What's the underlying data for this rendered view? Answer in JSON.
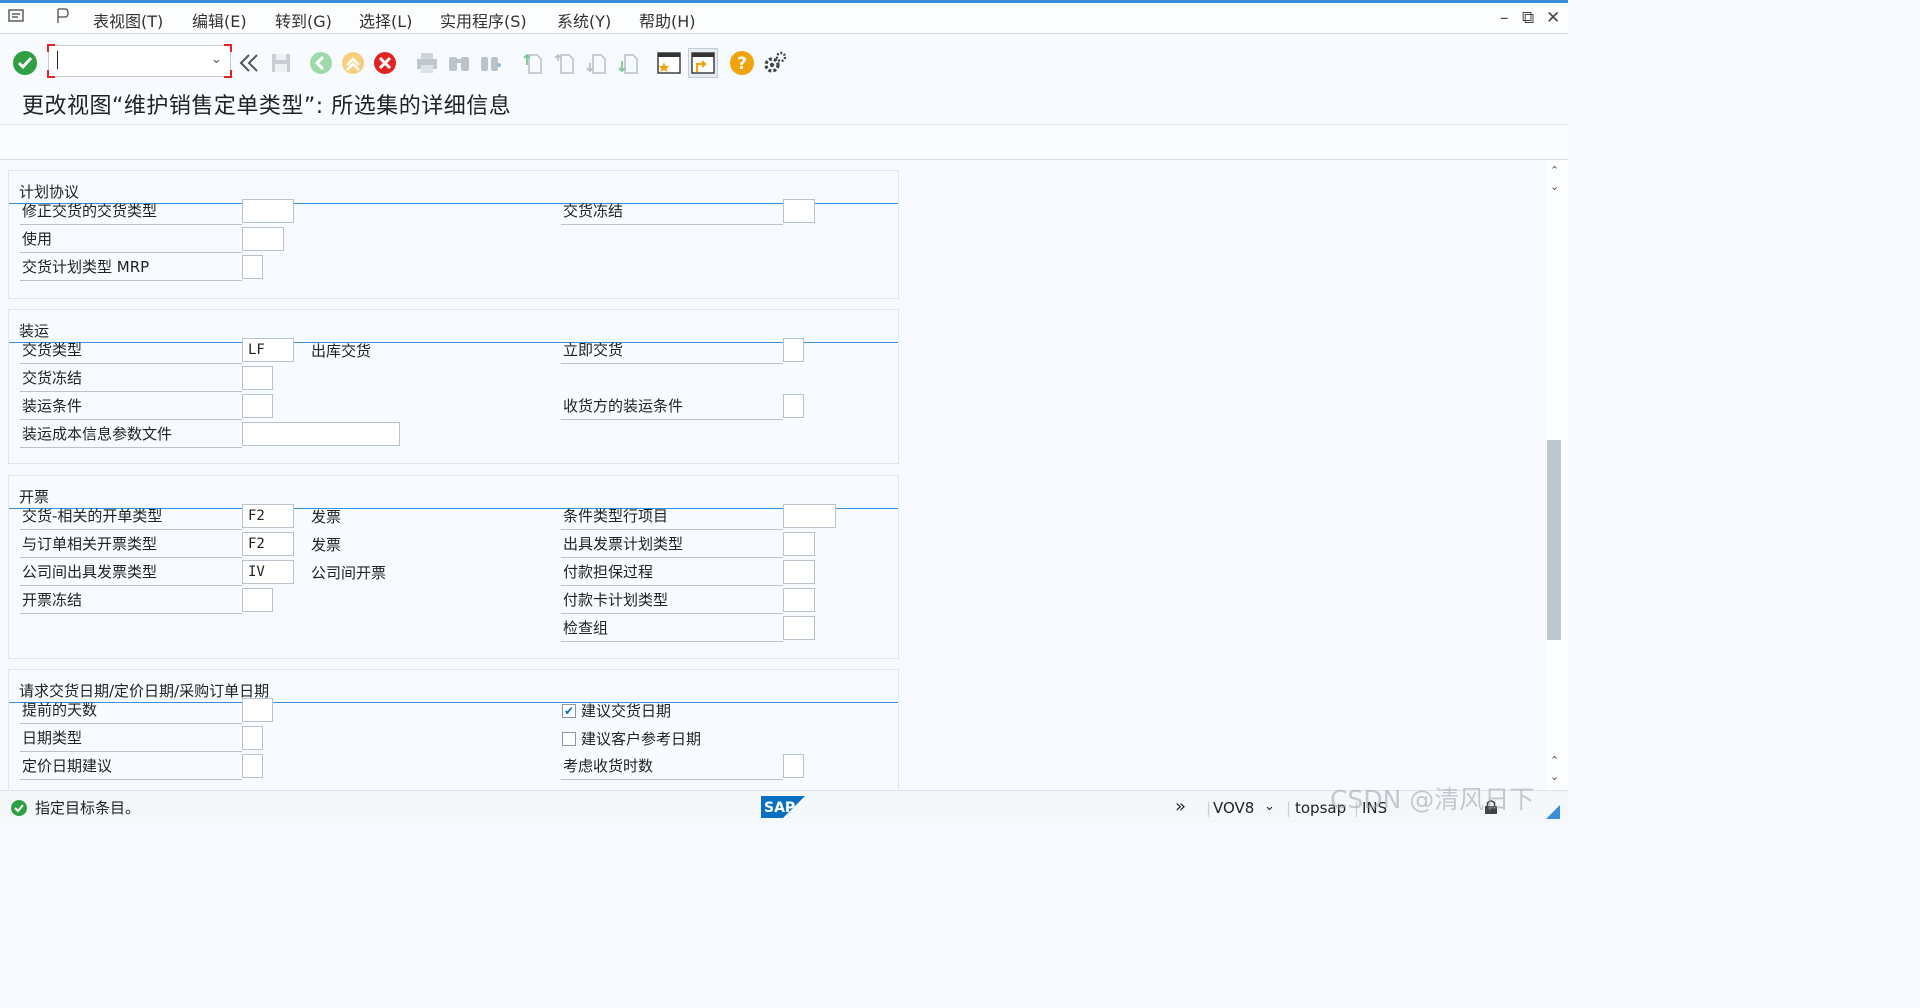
{
  "menu": {
    "items": [
      "表视图(T)",
      "编辑(E)",
      "转到(G)",
      "选择(L)",
      "实用程序(S)",
      "系统(Y)",
      "帮助(H)"
    ]
  },
  "toolbar": {
    "command_field_value": "",
    "icons": [
      "enter-check",
      "command-field",
      "back-double",
      "save",
      "back",
      "exit",
      "cancel",
      "print",
      "find",
      "find-next",
      "first-page",
      "previous-page",
      "next-page",
      "last-page",
      "new-session",
      "shortcut",
      "help",
      "customize-layout"
    ]
  },
  "page": {
    "title": "更改视图“维护销售定单类型”: 所选集的详细信息"
  },
  "groups": {
    "schedule": {
      "header": "计划协议",
      "fields": [
        {
          "label": "修正交货的交货类型",
          "value": ""
        },
        {
          "label": "使用",
          "value": ""
        },
        {
          "label": "交货计划类型 MRP",
          "value": ""
        },
        {
          "label": "交货冻结",
          "value": ""
        }
      ]
    },
    "shipping": {
      "header": "装运",
      "fields": [
        {
          "label": "交货类型",
          "value": "LF",
          "desc": "出库交货"
        },
        {
          "label": "交货冻结",
          "value": ""
        },
        {
          "label": "装运条件",
          "value": ""
        },
        {
          "label": "装运成本信息参数文件",
          "value": ""
        },
        {
          "label": "立即交货",
          "value": ""
        },
        {
          "label": "收货方的装运条件",
          "value": ""
        }
      ]
    },
    "billing": {
      "header": "开票",
      "fields": [
        {
          "label": "交货-相关的开单类型",
          "value": "F2",
          "desc": "发票"
        },
        {
          "label": "与订单相关开票类型",
          "value": "F2",
          "desc": "发票"
        },
        {
          "label": "公司间出具发票类型",
          "value": "IV",
          "desc": "公司间开票"
        },
        {
          "label": "开票冻结",
          "value": ""
        },
        {
          "label": "条件类型行项目",
          "value": ""
        },
        {
          "label": "出具发票计划类型",
          "value": ""
        },
        {
          "label": "付款担保过程",
          "value": ""
        },
        {
          "label": "付款卡计划类型",
          "value": ""
        },
        {
          "label": "检查组",
          "value": ""
        }
      ]
    },
    "dates": {
      "header": "请求交货日期/定价日期/采购订单日期",
      "fields": [
        {
          "label": "提前的天数",
          "value": ""
        },
        {
          "label": "日期类型",
          "value": ""
        },
        {
          "label": "定价日期建议",
          "value": ""
        },
        {
          "label": "建议交货日期",
          "checked": true
        },
        {
          "label": "建议客户参考日期",
          "checked": false
        },
        {
          "label": "考虑收货时数",
          "value": ""
        }
      ]
    }
  },
  "status": {
    "message": "指定目标条目。",
    "transaction": "VOV8",
    "server": "topsap",
    "mode": "INS"
  },
  "watermark": "CSDN @清风日下",
  "colors": {
    "accent_blue": "#3a8dd7",
    "success_green": "#2ea043",
    "cancel_red": "#e02424",
    "help_orange": "#f0a30a"
  }
}
